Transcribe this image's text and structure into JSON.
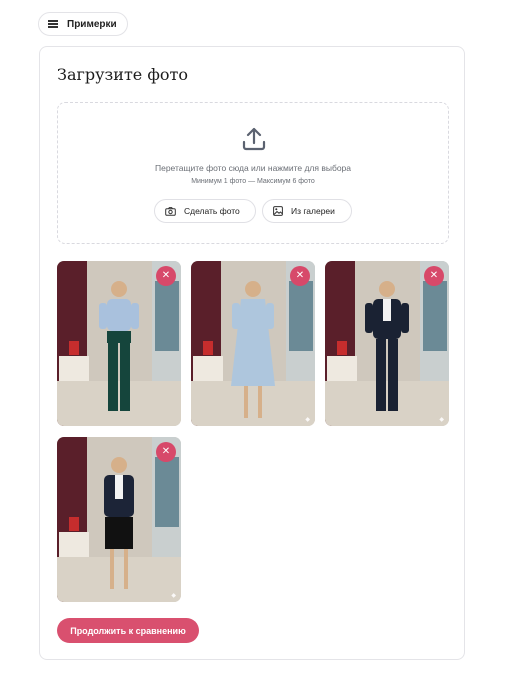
{
  "header": {
    "examples_label": "Примерки"
  },
  "upload": {
    "title": "Загрузите фото",
    "drop_text": "Перетащите фото сюда или нажмите для выбора",
    "limits_text": "Минимум 1 фото — Максимум 6 фото",
    "camera_label": "Сделать фото",
    "gallery_label": "Из галереи"
  },
  "photos": [
    {
      "outfit": "light-blue blouse, dark green trousers",
      "remove_symbol": "✕"
    },
    {
      "outfit": "light-blue printed dress",
      "remove_symbol": "✕"
    },
    {
      "outfit": "navy trouser suit, white shirt",
      "remove_symbol": "✕"
    },
    {
      "outfit": "navy blazer, black pencil skirt",
      "remove_symbol": "✕"
    }
  ],
  "actions": {
    "continue_label": "Продолжить к сравнению"
  },
  "colors": {
    "accent": "#d9506f",
    "remove": "#d7496a",
    "curtain": "#5a1f2a"
  }
}
